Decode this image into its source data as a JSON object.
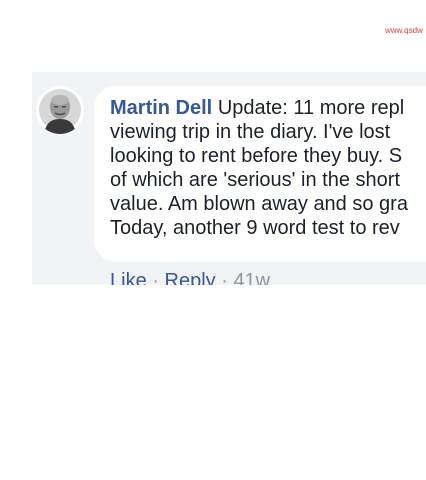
{
  "watermark": "www.qsdw",
  "comment": {
    "author": "Martin Dell",
    "lines": [
      "Update: 11 more repl",
      "viewing trip in the diary. I've lost",
      "looking to rent before they buy. S",
      "of which are 'serious' in the short",
      "value. Am blown away and so gra",
      "Today, another 9 word test to rev"
    ],
    "actions": {
      "like_label": "Like",
      "separator": "·",
      "reply_label": "Reply",
      "time": "41w"
    }
  },
  "avatar_icon": "user-photo-icon"
}
